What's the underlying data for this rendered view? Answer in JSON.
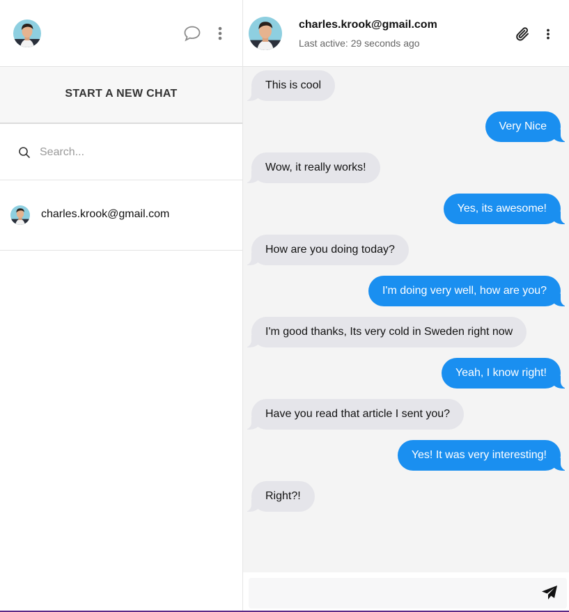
{
  "sidebar": {
    "new_chat_label": "START A NEW CHAT",
    "search": {
      "placeholder": "Search...",
      "value": ""
    },
    "contacts": [
      {
        "name": "charles.krook@gmail.com"
      }
    ],
    "icons": [
      "avatar",
      "chat-bubble-icon",
      "kebab-menu-icon",
      "search-icon"
    ]
  },
  "chat": {
    "title": "charles.krook@gmail.com",
    "status": "Last active: 29 seconds ago",
    "icons": [
      "paperclip-icon",
      "kebab-menu-icon",
      "send-icon"
    ],
    "messages": [
      {
        "from": "in",
        "text": "This is cool"
      },
      {
        "from": "out",
        "text": "Very Nice"
      },
      {
        "from": "in",
        "text": "Wow, it really works!"
      },
      {
        "from": "out",
        "text": "Yes, its awesome!"
      },
      {
        "from": "in",
        "text": "How are you doing today?"
      },
      {
        "from": "out",
        "text": "I'm doing very well, how are you?"
      },
      {
        "from": "in",
        "text": "I'm good thanks, Its very cold in Sweden right now"
      },
      {
        "from": "out",
        "text": "Yeah, I know right!"
      },
      {
        "from": "in",
        "text": "Have you read that article I sent you?"
      },
      {
        "from": "out",
        "text": "Yes! It was very interesting!"
      },
      {
        "from": "in",
        "text": "Right?!"
      }
    ],
    "composer": {
      "value": "",
      "placeholder": ""
    }
  },
  "colors": {
    "incoming_bubble": "#e5e5ea",
    "outgoing_bubble": "#1a8ff0",
    "chat_background": "#f4f4f4"
  }
}
